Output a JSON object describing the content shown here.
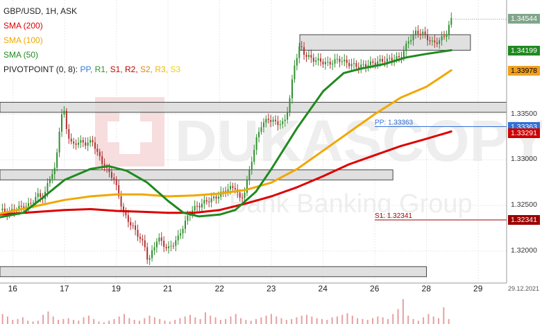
{
  "header": {
    "symbol": "GBP/USD, 1H, ASK",
    "sma200": "SMA (200)",
    "sma100": "SMA (100)",
    "sma50": "SMA (50)",
    "pivot_prefix": "PIVOTPOINT (0, 8): ",
    "pivot_items": [
      {
        "label": "PP",
        "color": "#2f7bd6"
      },
      {
        "label": "R1",
        "color": "#2f8f2f"
      },
      {
        "label": "S1",
        "color": "#cc0000"
      },
      {
        "label": "R2",
        "color": "#b00000"
      },
      {
        "label": "S2",
        "color": "#e08a00"
      },
      {
        "label": "R3",
        "color": "#f0b400"
      },
      {
        "label": "S3",
        "color": "#f2d000"
      }
    ]
  },
  "watermark": {
    "brand": "DUKASCOPY",
    "sub": "Bank Banking Group"
  },
  "price_tags": [
    {
      "label": "1.34544",
      "price": 1.34544,
      "bg": "#7fa58a",
      "fg": "#ffffff"
    },
    {
      "label": "1.34199",
      "price": 1.34199,
      "bg": "#1f8a1f",
      "fg": "#ffffff"
    },
    {
      "label": "1.33978",
      "price": 1.33978,
      "bg": "#f0a020",
      "fg": "#000000"
    },
    {
      "label": "1.33363",
      "price": 1.33363,
      "bg": "#2f6fd6",
      "fg": "#ffffff"
    },
    {
      "label": "1.33291",
      "price": 1.33291,
      "bg": "#cc0000",
      "fg": "#ffffff"
    },
    {
      "label": "1.32341",
      "price": 1.32341,
      "bg": "#9b0000",
      "fg": "#ffffff"
    }
  ],
  "pivot_lines": [
    {
      "label": "PP: 1.33363",
      "price": 1.33363,
      "color": "#2f6fd6"
    },
    {
      "label": "S1: 1.32341",
      "price": 1.32341,
      "color": "#9b0000"
    }
  ],
  "date_stamp": "29.12.2021",
  "chart_data": {
    "type": "line",
    "title": "GBP/USD, 1H, ASK",
    "x_ticks": [
      {
        "label": "16",
        "day": 0
      },
      {
        "label": "17",
        "day": 1
      },
      {
        "label": "19",
        "day": 2
      },
      {
        "label": "21",
        "day": 3
      },
      {
        "label": "22",
        "day": 4
      },
      {
        "label": "23",
        "day": 5
      },
      {
        "label": "24",
        "day": 6
      },
      {
        "label": "26",
        "day": 7
      },
      {
        "label": "28",
        "day": 8
      },
      {
        "label": "29",
        "day": 9
      }
    ],
    "y_ticks": [
      {
        "label": "1.33500",
        "value": 1.335
      },
      {
        "label": "1.33000",
        "value": 1.33
      },
      {
        "label": "1.32500",
        "value": 1.325
      },
      {
        "label": "1.32000",
        "value": 1.32
      }
    ],
    "ylim": [
      1.3165,
      1.3475
    ],
    "xlim": [
      -0.25,
      9.55
    ],
    "series": [
      {
        "name": "SMA (200)",
        "color": "#dd0000",
        "points": [
          [
            -0.25,
            1.324
          ],
          [
            0.5,
            1.3243
          ],
          [
            1.0,
            1.3245
          ],
          [
            1.5,
            1.3246
          ],
          [
            2.0,
            1.3244
          ],
          [
            2.5,
            1.3243
          ],
          [
            3.0,
            1.3242
          ],
          [
            3.5,
            1.3242
          ],
          [
            4.0,
            1.3245
          ],
          [
            4.5,
            1.3252
          ],
          [
            5.0,
            1.326
          ],
          [
            5.5,
            1.327
          ],
          [
            6.0,
            1.3282
          ],
          [
            6.5,
            1.3295
          ],
          [
            7.0,
            1.3305
          ],
          [
            7.5,
            1.3315
          ],
          [
            8.0,
            1.3323
          ],
          [
            8.48,
            1.3331
          ]
        ]
      },
      {
        "name": "SMA (100)",
        "color": "#f0a800",
        "points": [
          [
            -0.25,
            1.3241
          ],
          [
            0.5,
            1.325
          ],
          [
            1.0,
            1.3256
          ],
          [
            1.5,
            1.326
          ],
          [
            2.0,
            1.3262
          ],
          [
            2.5,
            1.3262
          ],
          [
            3.0,
            1.326
          ],
          [
            3.5,
            1.3261
          ],
          [
            4.0,
            1.3263
          ],
          [
            4.5,
            1.3267
          ],
          [
            5.0,
            1.3275
          ],
          [
            5.5,
            1.329
          ],
          [
            6.0,
            1.331
          ],
          [
            6.5,
            1.333
          ],
          [
            7.0,
            1.335
          ],
          [
            7.5,
            1.3368
          ],
          [
            8.0,
            1.338
          ],
          [
            8.48,
            1.3398
          ]
        ]
      },
      {
        "name": "SMA (50)",
        "color": "#1f8a1f",
        "points": [
          [
            -0.25,
            1.3237
          ],
          [
            0.2,
            1.3242
          ],
          [
            0.5,
            1.3255
          ],
          [
            1.0,
            1.3278
          ],
          [
            1.5,
            1.329
          ],
          [
            1.85,
            1.3293
          ],
          [
            2.2,
            1.3288
          ],
          [
            2.6,
            1.3275
          ],
          [
            3.0,
            1.3255
          ],
          [
            3.3,
            1.3242
          ],
          [
            3.6,
            1.3238
          ],
          [
            4.0,
            1.324
          ],
          [
            4.3,
            1.3245
          ],
          [
            4.7,
            1.3265
          ],
          [
            5.0,
            1.329
          ],
          [
            5.5,
            1.3335
          ],
          [
            6.0,
            1.3375
          ],
          [
            6.4,
            1.3395
          ],
          [
            6.75,
            1.34
          ],
          [
            7.2,
            1.3405
          ],
          [
            7.6,
            1.3412
          ],
          [
            8.0,
            1.3416
          ],
          [
            8.48,
            1.342
          ]
        ]
      }
    ],
    "price_line": [
      [
        -0.25,
        1.3245
      ],
      [
        -0.1,
        1.3242
      ],
      [
        0.1,
        1.3247
      ],
      [
        0.3,
        1.325
      ],
      [
        0.5,
        1.3262
      ],
      [
        0.6,
        1.3258
      ],
      [
        0.7,
        1.328
      ],
      [
        0.82,
        1.329
      ],
      [
        0.92,
        1.3345
      ],
      [
        0.98,
        1.3355
      ],
      [
        1.05,
        1.333
      ],
      [
        1.15,
        1.3315
      ],
      [
        1.25,
        1.332
      ],
      [
        1.4,
        1.3318
      ],
      [
        1.55,
        1.332
      ],
      [
        1.65,
        1.3305
      ],
      [
        1.8,
        1.329
      ],
      [
        1.95,
        1.328
      ],
      [
        2.05,
        1.326
      ],
      [
        2.15,
        1.324
      ],
      [
        2.3,
        1.3228
      ],
      [
        2.45,
        1.3215
      ],
      [
        2.55,
        1.3205
      ],
      [
        2.62,
        1.3188
      ],
      [
        2.7,
        1.32
      ],
      [
        2.8,
        1.3215
      ],
      [
        2.9,
        1.3208
      ],
      [
        3.0,
        1.3202
      ],
      [
        3.1,
        1.3208
      ],
      [
        3.2,
        1.3215
      ],
      [
        3.3,
        1.3228
      ],
      [
        3.45,
        1.3245
      ],
      [
        3.6,
        1.325
      ],
      [
        3.75,
        1.3255
      ],
      [
        3.9,
        1.3258
      ],
      [
        4.0,
        1.3262
      ],
      [
        4.15,
        1.3268
      ],
      [
        4.3,
        1.327
      ],
      [
        4.4,
        1.3255
      ],
      [
        4.5,
        1.3268
      ],
      [
        4.6,
        1.3295
      ],
      [
        4.7,
        1.332
      ],
      [
        4.8,
        1.3338
      ],
      [
        4.95,
        1.3345
      ],
      [
        5.1,
        1.334
      ],
      [
        5.25,
        1.334
      ],
      [
        5.35,
        1.3365
      ],
      [
        5.45,
        1.3405
      ],
      [
        5.55,
        1.3425
      ],
      [
        5.65,
        1.3415
      ],
      [
        5.8,
        1.341
      ],
      [
        5.95,
        1.3408
      ],
      [
        6.1,
        1.3405
      ],
      [
        6.3,
        1.341
      ],
      [
        6.5,
        1.3405
      ],
      [
        6.7,
        1.3402
      ],
      [
        6.9,
        1.3405
      ],
      [
        7.1,
        1.3408
      ],
      [
        7.3,
        1.341
      ],
      [
        7.5,
        1.3412
      ],
      [
        7.65,
        1.343
      ],
      [
        7.8,
        1.344
      ],
      [
        7.95,
        1.3438
      ],
      [
        8.1,
        1.3428
      ],
      [
        8.25,
        1.343
      ],
      [
        8.4,
        1.344
      ],
      [
        8.48,
        1.3454
      ]
    ],
    "zones": [
      {
        "x0": -0.25,
        "x1": 9.55,
        "y_low": 1.3352,
        "y_high": 1.3363
      },
      {
        "x0": -0.25,
        "x1": 7.35,
        "y_low": 1.3278,
        "y_high": 1.3289
      },
      {
        "x0": -0.25,
        "x1": 8.0,
        "y_low": 1.3172,
        "y_high": 1.3183
      },
      {
        "x0": 5.55,
        "x1": 8.85,
        "y_low": 1.342,
        "y_high": 1.3437
      }
    ],
    "volume_bars": [
      12,
      9,
      5,
      6,
      8,
      4,
      3,
      4,
      11,
      15,
      9,
      5,
      6,
      7,
      5,
      4,
      8,
      10,
      6,
      3,
      2,
      4,
      6,
      9,
      12,
      7,
      5,
      4,
      7,
      10,
      8,
      6,
      4,
      3,
      5,
      7,
      9,
      11,
      8,
      6,
      14,
      10,
      8,
      5,
      6,
      9,
      12,
      7,
      5,
      4,
      6,
      8,
      10,
      12,
      9,
      7,
      5,
      6,
      8,
      10,
      11,
      9,
      7,
      6,
      5,
      8,
      9,
      11,
      13,
      10,
      7,
      6,
      5,
      7,
      9,
      8,
      6,
      12,
      18,
      30,
      10,
      6,
      4,
      8,
      12,
      9,
      7,
      20,
      6
    ]
  }
}
